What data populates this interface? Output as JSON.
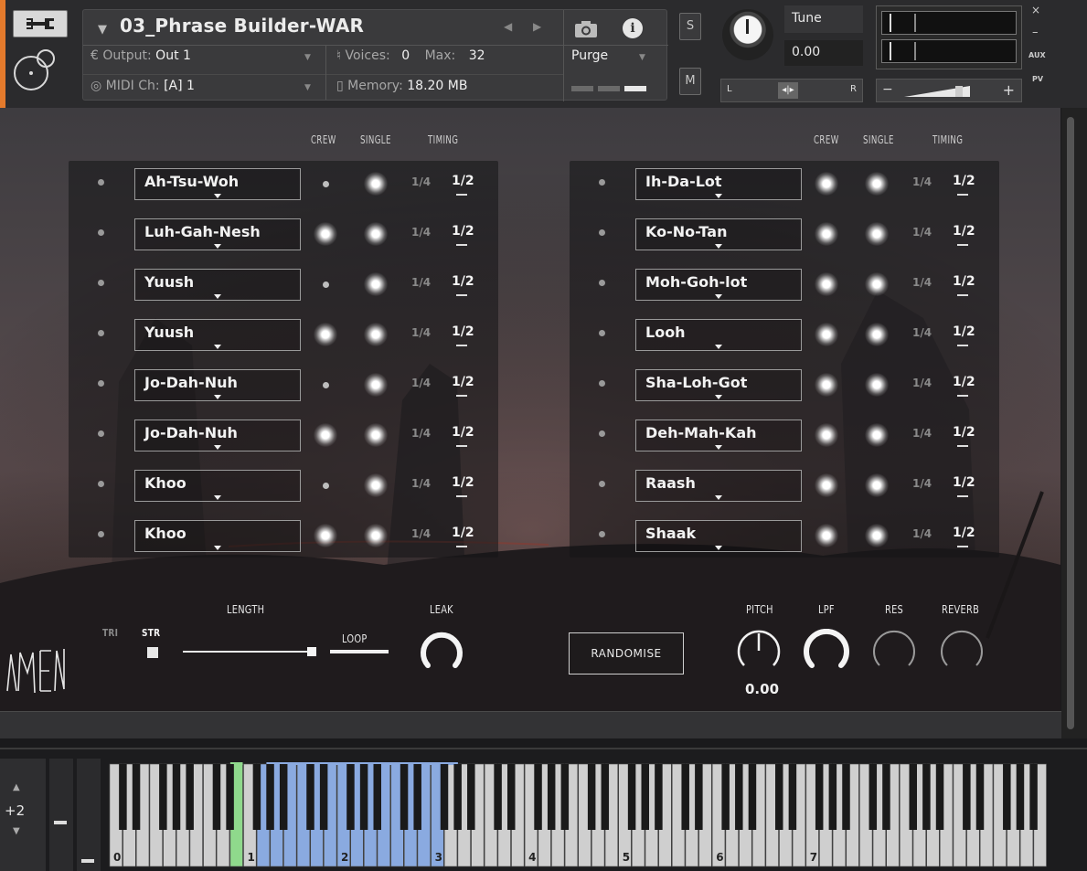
{
  "header": {
    "instrument_title": "03_Phrase Builder-WAR",
    "output_label": "Output:",
    "output_value": "Out 1",
    "midi_label": "MIDI Ch:",
    "midi_value": "[A]  1",
    "voices_label": "Voices:",
    "voices_value": "0",
    "max_label": "Max:",
    "max_value": "32",
    "memory_label": "Memory:",
    "memory_value": "18.20 MB",
    "purge_label": "Purge",
    "solo_label": "S",
    "mute_label": "M",
    "tune_label": "Tune",
    "tune_value": "0.00",
    "pan_left": "L",
    "pan_right": "R",
    "side_close": "×",
    "side_minimize": "–",
    "side_aux": "AUX",
    "side_pv": "PV",
    "icons": [
      "wrench-icon",
      "instrument-logo-icon",
      "camera-icon",
      "info-icon",
      "prev-arrow-icon",
      "next-arrow-icon"
    ],
    "colors": {
      "accent": "#e47a2c"
    }
  },
  "columns": {
    "crew": "CREW",
    "single": "SINGLE",
    "timing": "TIMING"
  },
  "left_rows": [
    {
      "name": "Ah-Tsu-Woh",
      "crew": "dot",
      "single": "glow",
      "quarter": "1/4",
      "half": "1/2"
    },
    {
      "name": "Luh-Gah-Nesh",
      "crew": "glow",
      "single": "glow",
      "quarter": "1/4",
      "half": "1/2"
    },
    {
      "name": "Yuush",
      "crew": "dot",
      "single": "glow",
      "quarter": "1/4",
      "half": "1/2"
    },
    {
      "name": "Yuush",
      "crew": "glow",
      "single": "glow",
      "quarter": "1/4",
      "half": "1/2"
    },
    {
      "name": "Jo-Dah-Nuh",
      "crew": "dot",
      "single": "glow",
      "quarter": "1/4",
      "half": "1/2"
    },
    {
      "name": "Jo-Dah-Nuh",
      "crew": "glow",
      "single": "glow",
      "quarter": "1/4",
      "half": "1/2"
    },
    {
      "name": "Khoo",
      "crew": "dot",
      "single": "glow",
      "quarter": "1/4",
      "half": "1/2"
    },
    {
      "name": "Khoo",
      "crew": "glow",
      "single": "glow",
      "quarter": "1/4",
      "half": "1/2"
    }
  ],
  "right_rows": [
    {
      "name": "Ih-Da-Lot",
      "crew": "glow",
      "single": "glow",
      "quarter": "1/4",
      "half": "1/2"
    },
    {
      "name": "Ko-No-Tan",
      "crew": "glow",
      "single": "glow",
      "quarter": "1/4",
      "half": "1/2"
    },
    {
      "name": "Moh-Goh-lot",
      "crew": "glow",
      "single": "glow",
      "quarter": "1/4",
      "half": "1/2"
    },
    {
      "name": "Looh",
      "crew": "glow",
      "single": "glow",
      "quarter": "1/4",
      "half": "1/2"
    },
    {
      "name": "Sha-Loh-Got",
      "crew": "glow",
      "single": "glow",
      "quarter": "1/4",
      "half": "1/2"
    },
    {
      "name": "Deh-Mah-Kah",
      "crew": "glow",
      "single": "glow",
      "quarter": "1/4",
      "half": "1/2"
    },
    {
      "name": "Raash",
      "crew": "glow",
      "single": "glow",
      "quarter": "1/4",
      "half": "1/2"
    },
    {
      "name": "Shaak",
      "crew": "glow",
      "single": "glow",
      "quarter": "1/4",
      "half": "1/2"
    }
  ],
  "controls": {
    "tri": "TRI",
    "str": "STR",
    "length": "LENGTH",
    "loop": "LOOP",
    "leak": "LEAK",
    "randomise": "RANDOMISE",
    "pitch": "PITCH",
    "pitch_value": "0.00",
    "lpf": "LPF",
    "res": "RES",
    "reverb": "REVERB",
    "brand_logo": "OMEN",
    "length_fraction": 0.95
  },
  "keyboard": {
    "octave_shift": "+2",
    "octave_labels": [
      "0",
      "1",
      "2",
      "3",
      "4",
      "5",
      "6",
      "7"
    ],
    "green_white_keys": [
      9
    ],
    "blue_white_key_range": [
      11,
      24
    ],
    "colors": {
      "green_key": "#8fd98c",
      "blue_key": "#8aaae0",
      "white_key": "#cfcfcf",
      "black_key": "#1a1a1a"
    }
  }
}
